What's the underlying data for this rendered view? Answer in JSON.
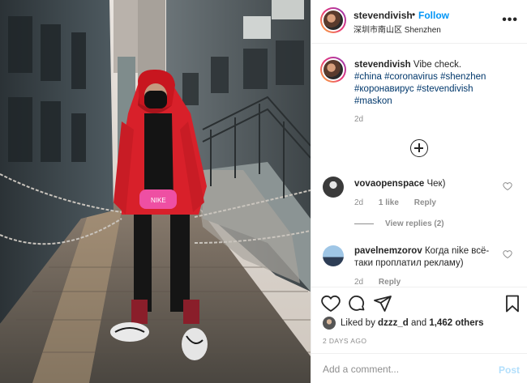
{
  "post": {
    "photo_alt": "Person in red hooded jacket and black face mask standing in a narrow alley",
    "user": "stevendivish",
    "separator": "•",
    "follow_label": "Follow",
    "location": "深圳市南山区 Shenzhen",
    "more_icon": "more-horizontal-icon",
    "caption": {
      "user": "stevendivish",
      "text": "Vibe check.",
      "tags_line1": "#china #coronavirus #shenzhen",
      "tags_line2": "#коронавирус #stevendivish",
      "tags_line3": "#maskon",
      "time": "2d"
    },
    "load_more_icon": "plus-circle-icon",
    "comments": [
      {
        "user": "vovaopenspace",
        "text": "Чек)",
        "time": "2d",
        "likes": "1 like",
        "reply": "Reply",
        "view_replies": "View replies (2)"
      },
      {
        "user": "pavelnemzorov",
        "text_line1": "Когда nike всё-",
        "text_line2": "таки проплатил рекламу)",
        "time": "2d",
        "reply": "Reply"
      }
    ],
    "actions": {
      "like": "heart-icon",
      "comment": "comment-icon",
      "share": "paper-plane-icon",
      "save": "bookmark-icon"
    },
    "liked_by": {
      "prefix": "Liked by",
      "user": "dzzz_d",
      "and": "and",
      "count": "1,462 others"
    },
    "date": "2 DAYS AGO",
    "add_comment_placeholder": "Add a comment...",
    "post_label": "Post"
  },
  "colors": {
    "link_blue": "#0095f6",
    "hashtag": "#00376b",
    "muted": "#8e8e8e",
    "post_disabled": "#b2dffc",
    "jacket_red": "#d8202a"
  }
}
